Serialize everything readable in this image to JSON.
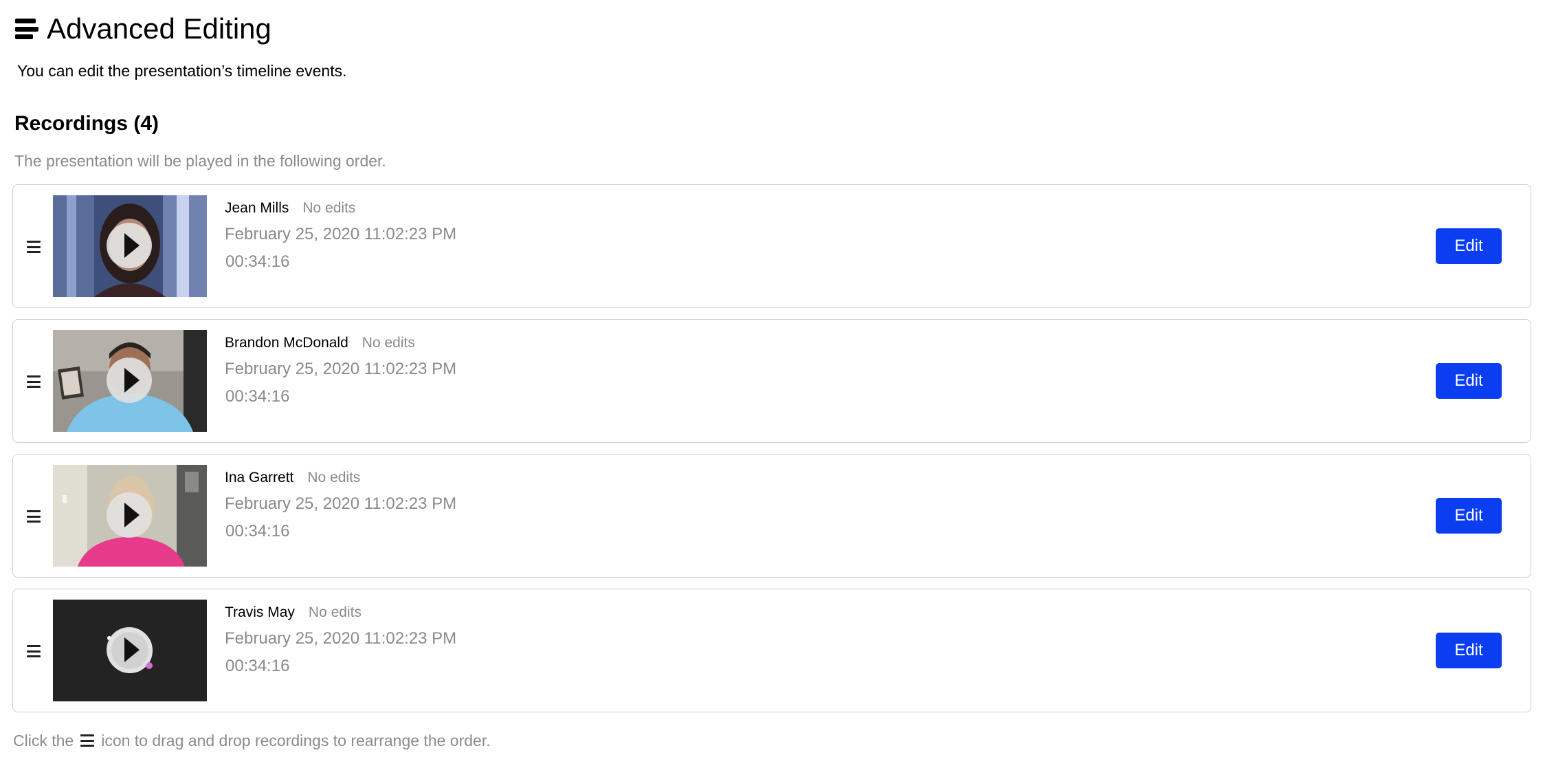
{
  "page": {
    "title": "Advanced Editing",
    "intro": "You can edit the presentation’s timeline events."
  },
  "recordings": {
    "heading": "Recordings (4)",
    "subtitle": "The presentation will be played in the following order.",
    "items": [
      {
        "name": "Jean Mills",
        "edit_status": "No edits",
        "datetime": "February 25, 2020  11:02:23 PM",
        "duration": "00:34:16",
        "edit_label": "Edit",
        "thumb_icon": "video-thumbnail-woman-dark-hair"
      },
      {
        "name": "Brandon McDonald",
        "edit_status": "No edits",
        "datetime": "February 25, 2020  11:02:23 PM",
        "duration": "00:34:16",
        "edit_label": "Edit",
        "thumb_icon": "video-thumbnail-man-blue-shirt"
      },
      {
        "name": "Ina Garrett",
        "edit_status": "No edits",
        "datetime": "February 25, 2020  11:02:23 PM",
        "duration": "00:34:16",
        "edit_label": "Edit",
        "thumb_icon": "video-thumbnail-woman-pink-shirt"
      },
      {
        "name": "Travis May",
        "edit_status": "No edits",
        "datetime": "February 25, 2020  11:02:23 PM",
        "duration": "00:34:16",
        "edit_label": "Edit",
        "thumb_icon": "video-thumbnail-dark-screen"
      }
    ]
  },
  "footer": {
    "prefix": "Click the",
    "suffix": "icon to drag and drop recordings to rearrange the order."
  },
  "colors": {
    "accent": "#0a3ef0",
    "muted_text": "#8a8a8a",
    "border": "#cfcfcf"
  }
}
